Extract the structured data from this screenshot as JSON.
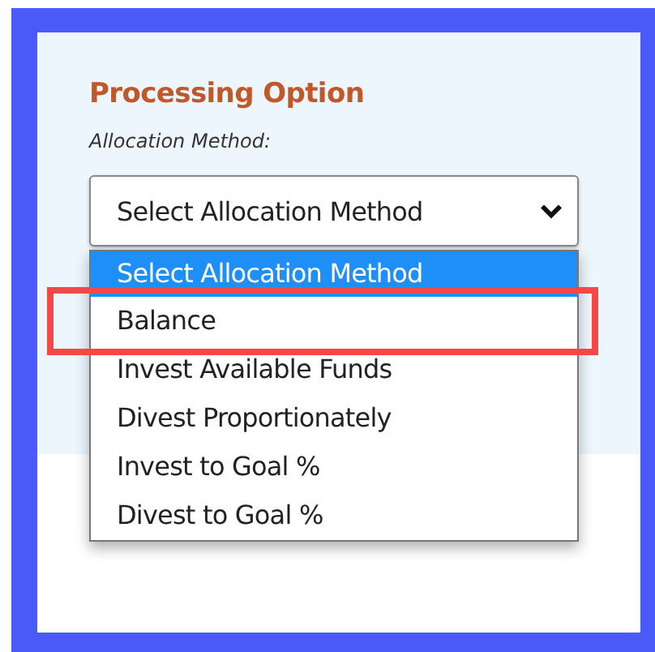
{
  "section": {
    "title": "Processing Option",
    "field_label": "Allocation Method:"
  },
  "select": {
    "value": "Select Allocation Method",
    "expanded": true
  },
  "options": [
    {
      "label": "Select Allocation Method",
      "selected": true,
      "highlighted": false
    },
    {
      "label": "Balance",
      "selected": false,
      "highlighted": true
    },
    {
      "label": "Invest Available Funds",
      "selected": false,
      "highlighted": false
    },
    {
      "label": "Divest Proportionately",
      "selected": false,
      "highlighted": false
    },
    {
      "label": "Invest to Goal %",
      "selected": false,
      "highlighted": false
    },
    {
      "label": "Divest to Goal %",
      "selected": false,
      "highlighted": false
    }
  ]
}
